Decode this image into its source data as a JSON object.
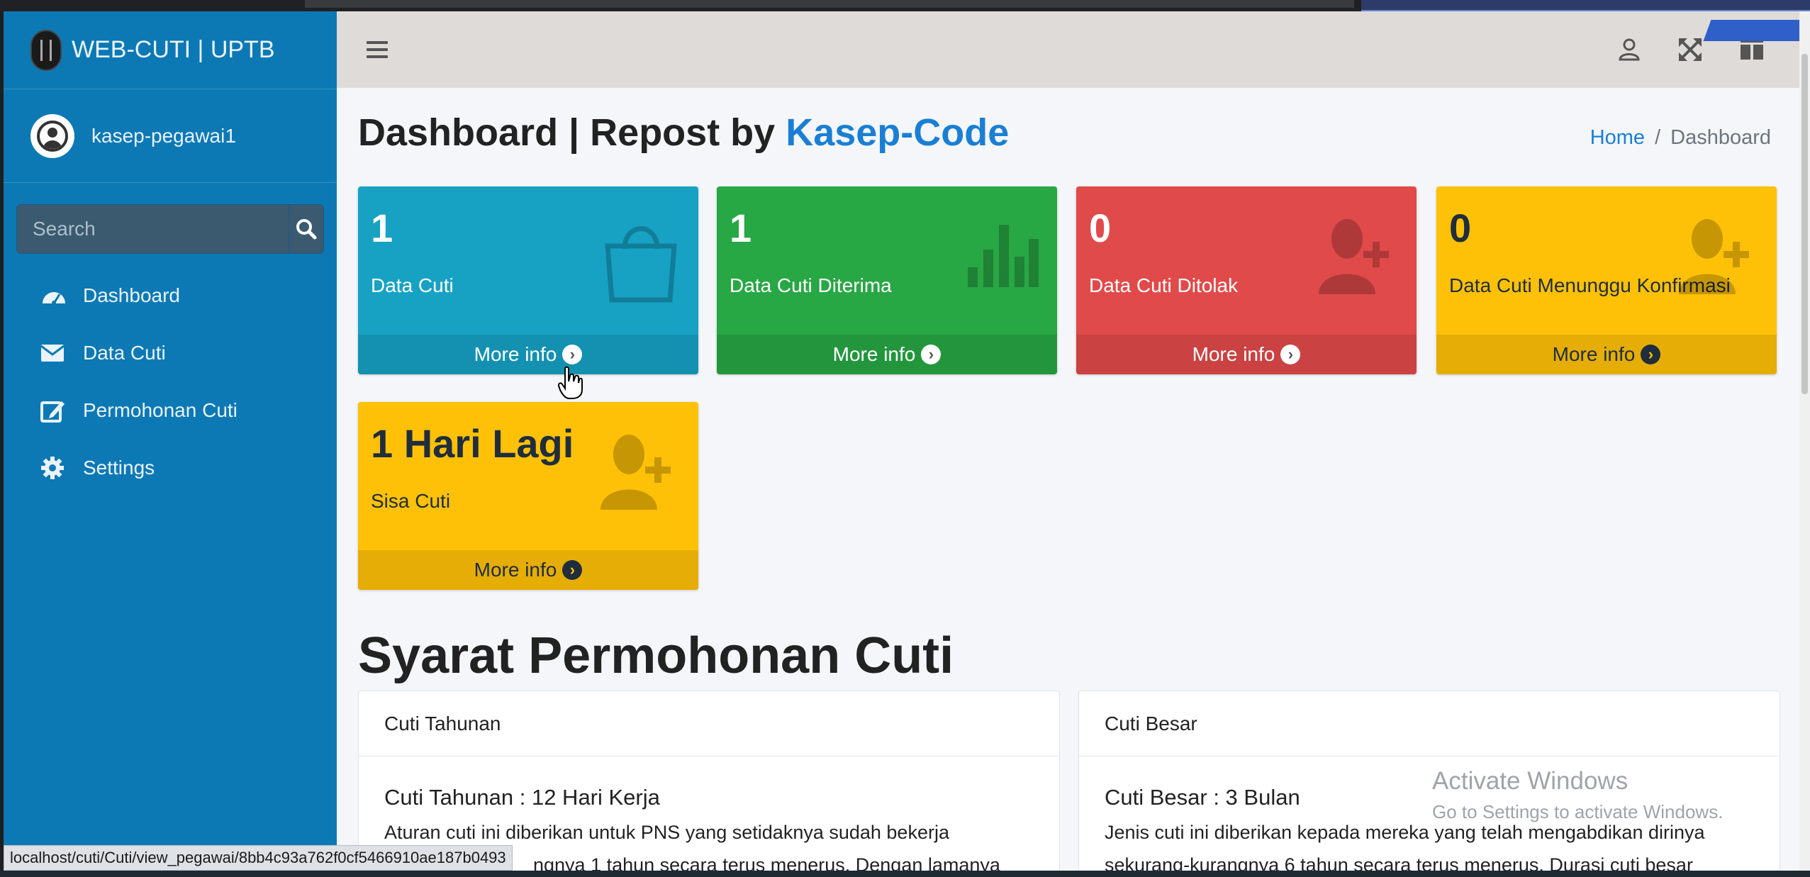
{
  "brand": {
    "title": "WEB-CUTI | UPTB"
  },
  "user": {
    "name": "kasep-pegawai1"
  },
  "search": {
    "placeholder": "Search"
  },
  "nav": [
    {
      "label": "Dashboard",
      "icon": "dashboard-icon"
    },
    {
      "label": "Data Cuti",
      "icon": "envelope-icon"
    },
    {
      "label": "Permohonan Cuti",
      "icon": "edit-icon"
    },
    {
      "label": "Settings",
      "icon": "gear-icon"
    }
  ],
  "header": {
    "title_prefix": "Dashboard | Repost by ",
    "title_accent": "Kasep-Code",
    "breadcrumb": {
      "home": "Home",
      "separator": "/",
      "current": "Dashboard"
    }
  },
  "boxes": [
    {
      "value": "1",
      "label": "Data Cuti",
      "footer": "More info",
      "color": "#17a2c4",
      "icon": "shopping-bag-icon"
    },
    {
      "value": "1",
      "label": "Data Cuti Diterima",
      "footer": "More info",
      "color": "#28a745",
      "icon": "bar-chart-icon"
    },
    {
      "value": "0",
      "label": "Data Cuti Ditolak",
      "footer": "More info",
      "color": "#e14a4a",
      "icon": "user-plus-icon"
    },
    {
      "value": "0",
      "label": "Data Cuti Menunggu Konfirmasi",
      "footer": "More info",
      "color": "#ffc107",
      "icon": "user-plus-icon"
    },
    {
      "value": "1 Hari Lagi",
      "label": "Sisa Cuti",
      "footer": "More info",
      "color": "#ffc107",
      "icon": "user-plus-icon"
    }
  ],
  "section": {
    "title": "Syarat Permohonan Cuti"
  },
  "cards": [
    {
      "header": "Cuti Tahunan",
      "subtitle": "Cuti Tahunan : 12 Hari Kerja",
      "line1": "Aturan cuti ini diberikan untuk PNS yang setidaknya sudah bekerja",
      "line2": "ngnya 1 tahun secara terus menerus. Dengan lamanya"
    },
    {
      "header": "Cuti Besar",
      "subtitle": "Cuti Besar : 3 Bulan",
      "line1": "Jenis cuti ini diberikan kepada mereka yang telah mengabdikan dirinya",
      "line2": "sekurang-kurangnya 6 tahun secara terus menerus. Durasi cuti besar"
    }
  ],
  "watermark": {
    "line1": "Activate Windows",
    "line2": "Go to Settings to activate Windows."
  },
  "statusbar": {
    "url": "localhost/cuti/Cuti/view_pegawai/8bb4c93a762f0cf5466910ae187b0493"
  }
}
